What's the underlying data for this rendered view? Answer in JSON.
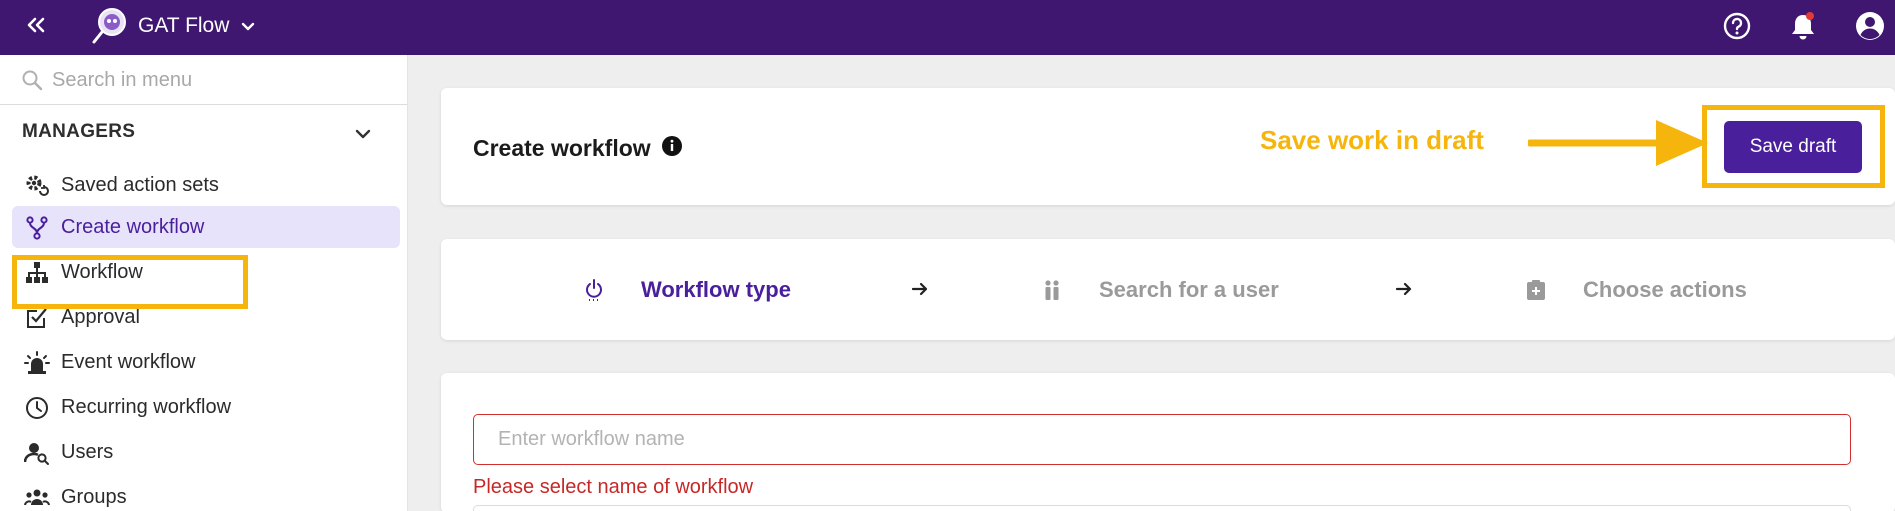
{
  "topbar": {
    "app_name": "GAT Flow",
    "icons": [
      "double-chevron-left-icon",
      "gat-flow-logo",
      "chevron-down-icon",
      "help-icon",
      "bell-icon",
      "account-icon"
    ],
    "notification_dot_color": "#e53935"
  },
  "sidebar": {
    "search_placeholder": "Search in menu",
    "section_title": "MANAGERS",
    "items": [
      {
        "label": "Saved action sets",
        "icon": "gear-refresh-icon"
      },
      {
        "label": "Create workflow",
        "icon": "fork-icon",
        "active": true
      },
      {
        "label": "Workflow",
        "icon": "hierarchy-icon"
      },
      {
        "label": "Approval",
        "icon": "checkbox-edit-icon"
      },
      {
        "label": "Event workflow",
        "icon": "alarm-light-icon"
      },
      {
        "label": "Recurring workflow",
        "icon": "clock-icon"
      },
      {
        "label": "Users",
        "icon": "user-search-icon"
      },
      {
        "label": "Groups",
        "icon": "group-icon"
      }
    ]
  },
  "header": {
    "title": "Create workflow",
    "annotation": "Save work in draft",
    "save_button": "Save draft"
  },
  "steps": [
    {
      "label": "Workflow type",
      "icon": "power-icon",
      "active": true
    },
    {
      "label": "Search for a user",
      "icon": "people-icon",
      "active": false
    },
    {
      "label": "Choose actions",
      "icon": "clipboard-icon",
      "active": false
    }
  ],
  "form": {
    "name_placeholder": "Enter workflow name",
    "name_value": "",
    "error": "Please select name of workflow"
  },
  "colors": {
    "brand": "#3f1670",
    "accent": "#4a1f9c",
    "annotation": "#f6b50c",
    "error": "#c62828"
  }
}
